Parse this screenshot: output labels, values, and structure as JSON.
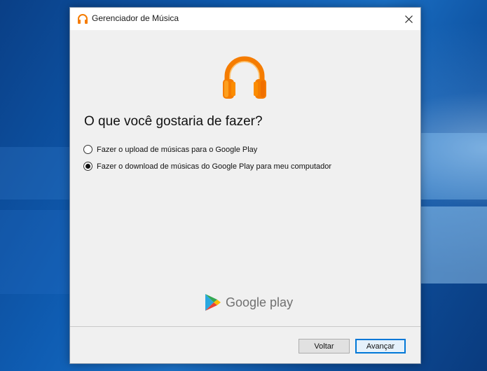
{
  "window": {
    "title": "Gerenciador de Música",
    "app_icon": "headphones-icon",
    "close_icon": "close-icon"
  },
  "main": {
    "logo_icon": "headphones-icon",
    "question": "O que você gostaria de fazer?",
    "options": [
      {
        "label": "Fazer o upload de músicas para o Google Play",
        "selected": false
      },
      {
        "label": "Fazer o download de músicas do Google Play para meu computador",
        "selected": true
      }
    ],
    "brand_text": "Google play"
  },
  "footer": {
    "back_label": "Voltar",
    "next_label": "Avançar"
  },
  "colors": {
    "accent_orange": "#f57c00",
    "button_focus": "#0078d7"
  }
}
